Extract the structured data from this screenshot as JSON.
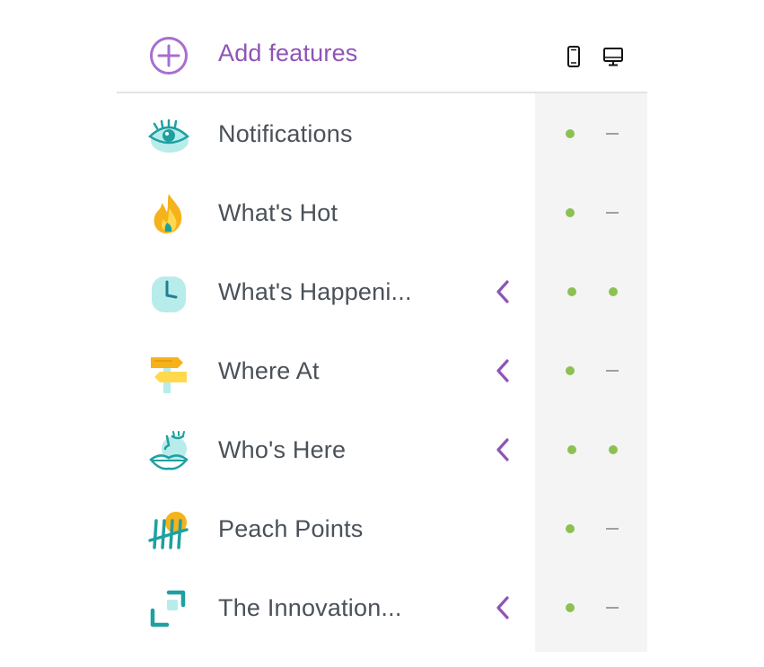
{
  "header": {
    "add_label": "Add features",
    "add_icon": "plus-circle-icon",
    "mobile_icon": "mobile-phone-icon",
    "desktop_icon": "desktop-monitor-icon"
  },
  "colors": {
    "accent": "#8e54b6",
    "text": "#4a5159",
    "enabled_dot": "#8cc152",
    "disabled_dash": "#9aa0a6",
    "column_bg": "#f4f4f4"
  },
  "features": [
    {
      "label": "Notifications",
      "icon": "eye-icon",
      "has_chevron": false,
      "mobile": "enabled",
      "desktop": "disabled"
    },
    {
      "label": "What's Hot",
      "icon": "fire-icon",
      "has_chevron": false,
      "mobile": "enabled",
      "desktop": "disabled"
    },
    {
      "label": "What's Happeni...",
      "icon": "clock-icon",
      "has_chevron": true,
      "mobile": "enabled",
      "desktop": "enabled"
    },
    {
      "label": "Where At",
      "icon": "signpost-icon",
      "has_chevron": true,
      "mobile": "enabled",
      "desktop": "disabled"
    },
    {
      "label": "Who's Here",
      "icon": "face-icon",
      "has_chevron": true,
      "mobile": "enabled",
      "desktop": "enabled"
    },
    {
      "label": "Peach Points",
      "icon": "tally-marks-icon",
      "has_chevron": false,
      "mobile": "enabled",
      "desktop": "disabled"
    },
    {
      "label": "The Innovation...",
      "icon": "expand-frame-icon",
      "has_chevron": true,
      "mobile": "enabled",
      "desktop": "disabled"
    }
  ]
}
